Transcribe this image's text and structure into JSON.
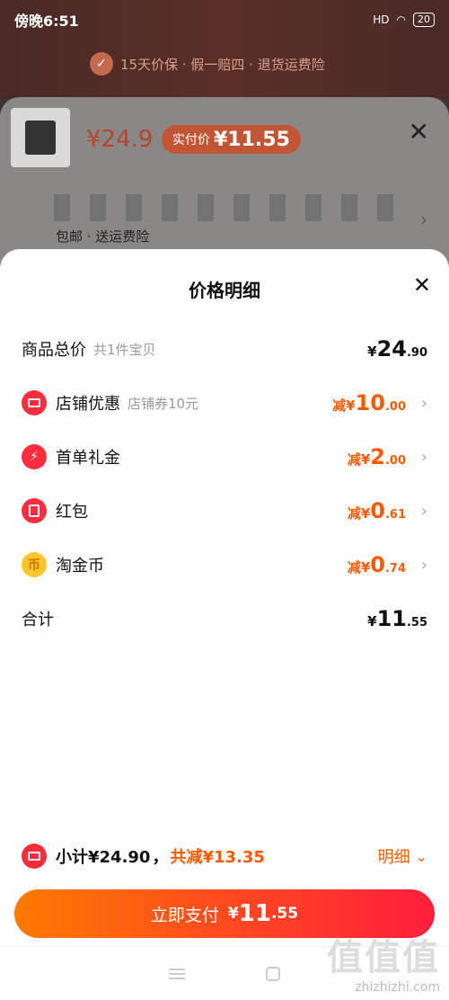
{
  "status_bar": {
    "time": "傍晚6:51",
    "signal": "HD",
    "battery": "20"
  },
  "background": {
    "guarantee": "15天价保 · 假一赔四 · 退货运费险",
    "price": "¥24.9",
    "real_price_label": "实付价",
    "real_price": "¥11.55",
    "insure_text": "包邮 · 送运费险"
  },
  "sheet": {
    "title": "价格明细",
    "rows": [
      {
        "label": "商品总价",
        "sub": "共1件宝贝",
        "prefix": "¥",
        "int": "24",
        "dec": ".90"
      },
      {
        "label": "店铺优惠",
        "sub": "店铺券10元",
        "prefix": "减¥",
        "int": "10",
        "dec": ".00",
        "icon": "shop-icon"
      },
      {
        "label": "首单礼金",
        "sub": "",
        "prefix": "减¥",
        "int": "2",
        "dec": ".00",
        "icon": "bolt-icon"
      },
      {
        "label": "红包",
        "sub": "",
        "prefix": "减¥",
        "int": "0",
        "dec": ".61",
        "icon": "red-envelope-icon"
      },
      {
        "label": "淘金币",
        "sub": "",
        "prefix": "减¥",
        "int": "0",
        "dec": ".74",
        "icon": "coin-icon"
      },
      {
        "label": "合计",
        "sub": "",
        "prefix": "¥",
        "int": "11",
        "dec": ".55"
      }
    ],
    "summary": {
      "subtotal": "小计¥24.90",
      "comma": "，",
      "saved": "共减¥13.35",
      "detail": "明细"
    },
    "pay": {
      "label": "立即支付",
      "prefix": "¥",
      "int": "11",
      "dec": ".55"
    }
  },
  "icons": {
    "coin_glyph": "币",
    "bolt_glyph": "⚡",
    "close_glyph": "✕",
    "chevron_glyph": "›",
    "chevron_down_glyph": "⌄"
  },
  "watermark": {
    "big": "值值值",
    "small": "zhizhizhi.com"
  },
  "colors": {
    "accent": "#ff5a00",
    "red": "#ff2d3e"
  }
}
